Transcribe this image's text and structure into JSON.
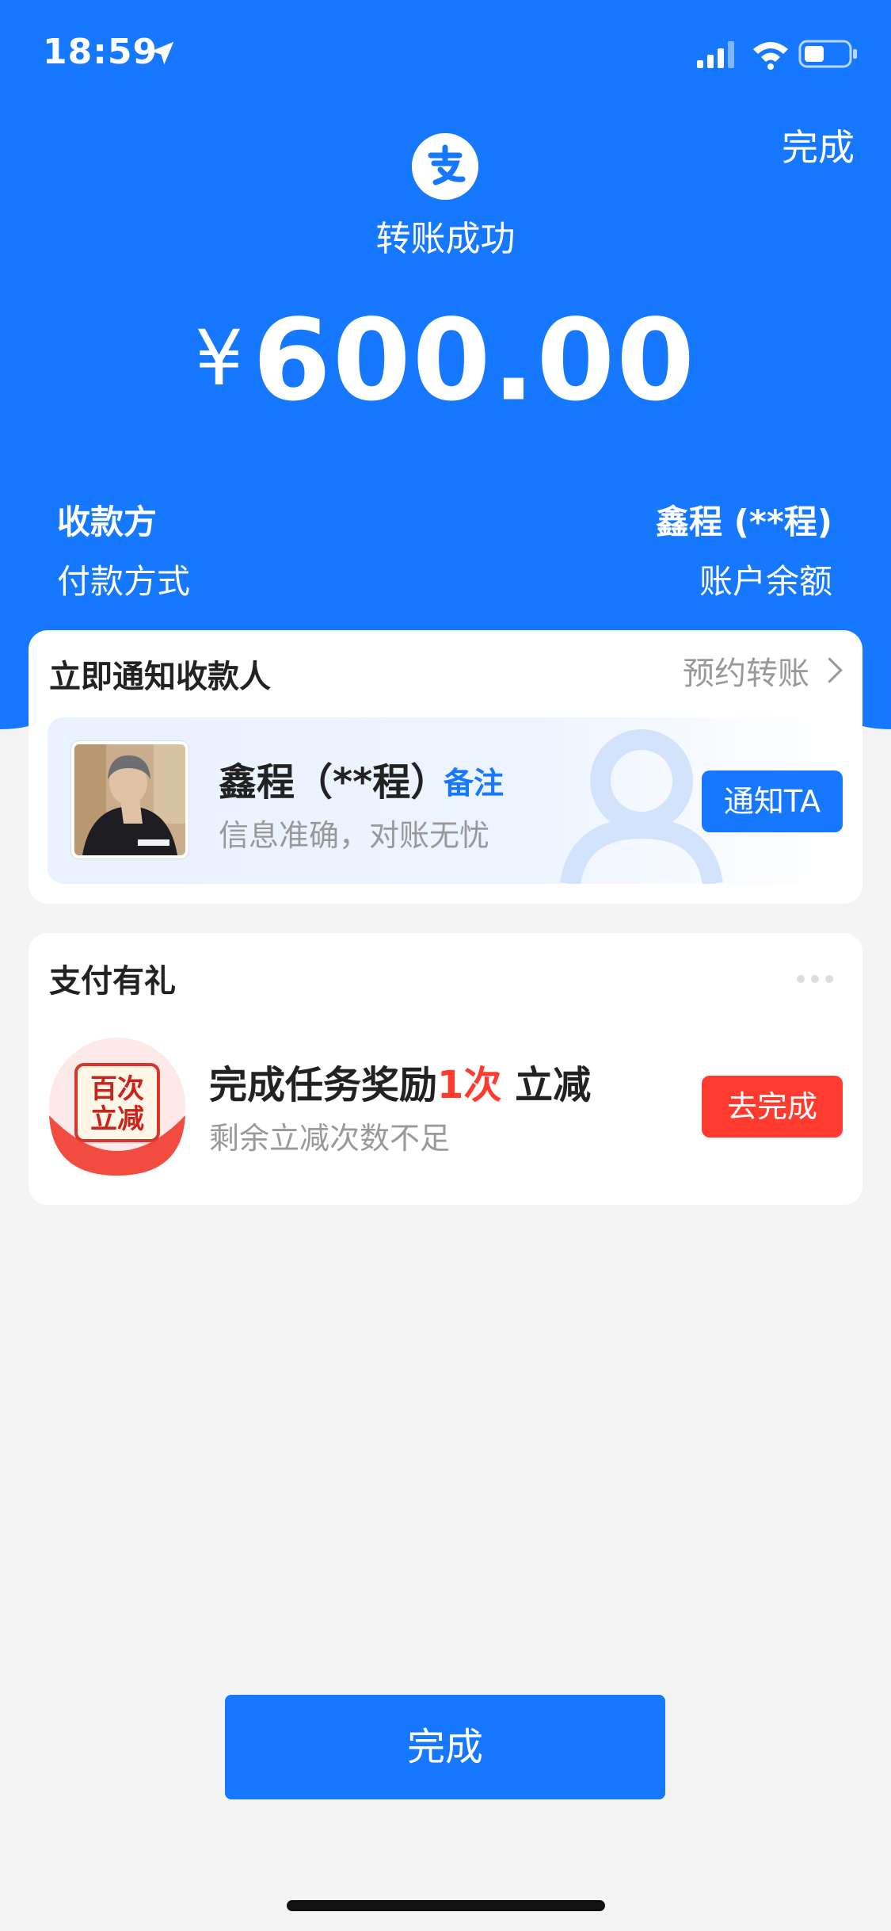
{
  "status_bar": {
    "time": "18:59"
  },
  "header": {
    "done_label": "完成",
    "title": "转账成功",
    "currency": "¥",
    "amount": "600.00"
  },
  "info": {
    "payee_label": "收款方",
    "payee_value": "鑫程 (**程)",
    "payment_label": "付款方式",
    "payment_value": "账户余额"
  },
  "notify_card": {
    "title": "立即通知收款人",
    "schedule_link": "预约转账",
    "payee_name": "鑫程（**程）",
    "remark_link": "备注",
    "subtitle": "信息准确，对账无忧",
    "notify_button": "通知TA"
  },
  "gift_card": {
    "title": "支付有礼",
    "task_prefix": "完成任务奖励",
    "task_count": "1次",
    "task_suffix": " 立减",
    "subtitle": "剩余立减次数不足",
    "badge_line1": "百次",
    "badge_line2": "立减",
    "go_button": "去完成"
  },
  "footer": {
    "done_button": "完成"
  },
  "colors": {
    "primary": "#1677ff",
    "danger": "#ff3b30",
    "background": "#f4f4f4"
  }
}
